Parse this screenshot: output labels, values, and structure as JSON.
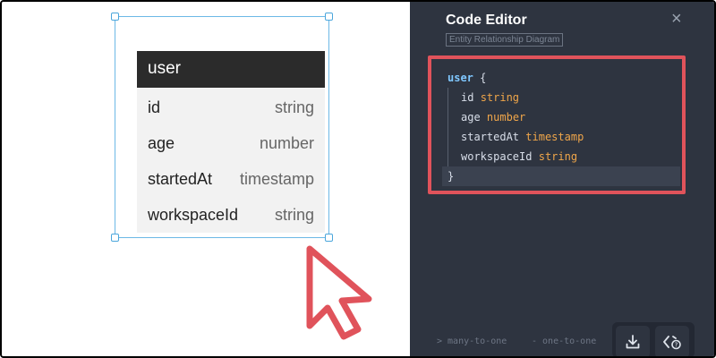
{
  "entity": {
    "name": "user",
    "fields": [
      {
        "name": "id",
        "type": "string"
      },
      {
        "name": "age",
        "type": "number"
      },
      {
        "name": "startedAt",
        "type": "timestamp"
      },
      {
        "name": "workspaceId",
        "type": "string"
      }
    ]
  },
  "editor": {
    "title": "Code Editor",
    "subtitle": "Entity Relationship Diagram",
    "close_icon": "×",
    "code": {
      "entity_name": "user",
      "open_brace": "{",
      "close_brace": "}",
      "lines": [
        {
          "field": "id",
          "type": "string"
        },
        {
          "field": "age",
          "type": "number"
        },
        {
          "field": "startedAt",
          "type": "timestamp"
        },
        {
          "field": "workspaceId",
          "type": "string"
        }
      ]
    },
    "legend": {
      "many_to_one": "> many-to-one",
      "one_to_one": "- one-to-one"
    },
    "buttons": {
      "download_icon": "download-icon",
      "code_help_icon": "code-help-icon"
    }
  },
  "colors": {
    "accent_highlight": "#e0535b",
    "selection": "#6cb8e6",
    "editor_bg": "#2e3440",
    "entity_header": "#2b2b2b",
    "type_token": "#f0a64a",
    "name_token": "#7fc7ff"
  }
}
